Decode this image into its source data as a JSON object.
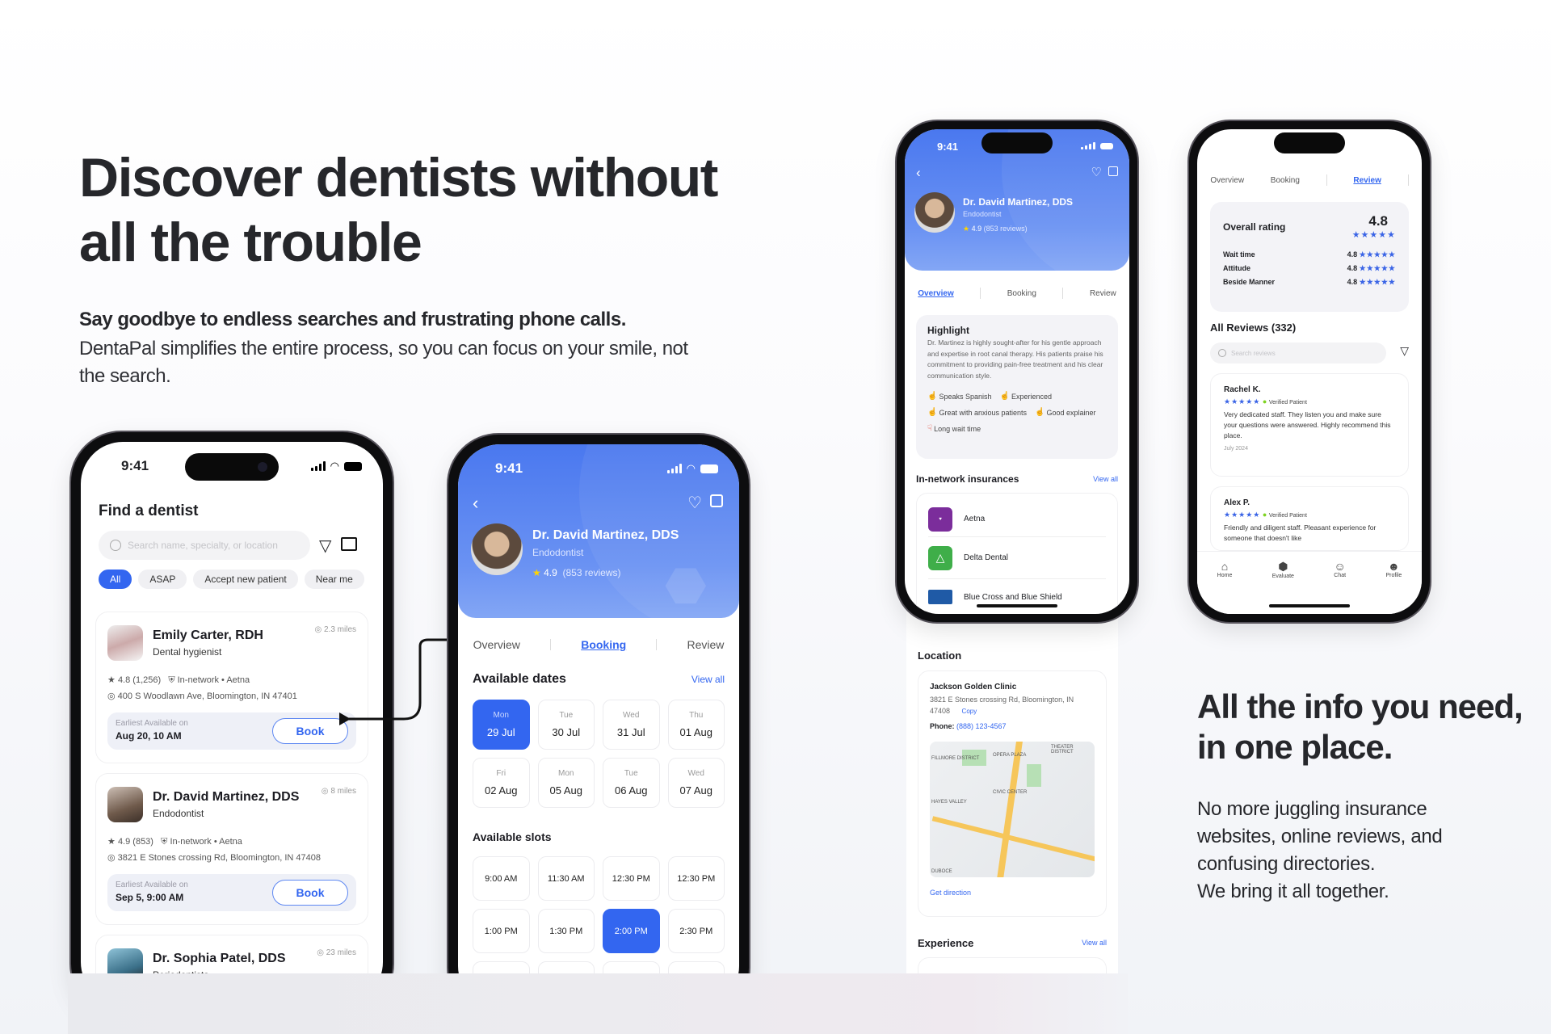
{
  "hero": {
    "title": "Discover dentists without all the trouble",
    "subtitle_bold": "Say goodbye to endless searches and frustrating phone calls.",
    "subtitle": "DentaPal simplifies the entire process, so you can focus on your smile, not the search."
  },
  "info": {
    "title": "All the info you need, in one place.",
    "body_lines": [
      "No more juggling insurance",
      "websites, online reviews, and",
      "confusing directories.",
      "We bring it all together."
    ]
  },
  "status_bar": {
    "time": "9:41"
  },
  "find": {
    "title": "Find a dentist",
    "search_placeholder": "Search name, specialty, or location",
    "chips": [
      "All",
      "ASAP",
      "Accept new patient",
      "Near me"
    ],
    "active_chip": "All",
    "dentists": [
      {
        "name": "Emily Carter, RDH",
        "specialty": "Dental hygienist",
        "distance": "2.3 miles",
        "rating": "4.8 (1,256)",
        "network": "In-network • Aetna",
        "address": "400 S Woodlawn Ave, Bloomington, IN 47401",
        "avail_label": "Earliest Available on",
        "avail": "Aug 20, 10 AM",
        "book": "Book"
      },
      {
        "name": "Dr. David Martinez, DDS",
        "specialty": "Endodontist",
        "distance": "8 miles",
        "rating": "4.9 (853)",
        "network": "In-network • Aetna",
        "address": "3821 E Stones crossing Rd, Bloomington, IN 47408",
        "avail_label": "Earliest Available on",
        "avail": "Sep 5, 9:00 AM",
        "book": "Book"
      },
      {
        "name": "Dr. Sophia Patel, DDS",
        "specialty": "Periodontists",
        "distance": "23 miles"
      }
    ]
  },
  "profile": {
    "name": "Dr. David Martinez, DDS",
    "specialty": "Endodontist",
    "rating": "4.9",
    "reviews": "(853 reviews)",
    "tabs": [
      "Overview",
      "Booking",
      "Review"
    ]
  },
  "booking": {
    "dates_title": "Available dates",
    "view_all": "View all",
    "dates": [
      {
        "day": "Mon",
        "date": "29 Jul",
        "selected": true
      },
      {
        "day": "Tue",
        "date": "30 Jul"
      },
      {
        "day": "Wed",
        "date": "31 Jul"
      },
      {
        "day": "Thu",
        "date": "01 Aug"
      },
      {
        "day": "Fri",
        "date": "02 Aug"
      },
      {
        "day": "Mon",
        "date": "05 Aug"
      },
      {
        "day": "Tue",
        "date": "06 Aug"
      },
      {
        "day": "Wed",
        "date": "07 Aug"
      }
    ],
    "slots_title": "Available slots",
    "slots": [
      "9:00 AM",
      "11:30 AM",
      "12:30 PM",
      "12:30 PM",
      "1:00 PM",
      "1:30 PM",
      "2:00 PM",
      "2:30 PM"
    ],
    "selected_slot": "2:00 PM"
  },
  "overview": {
    "highlight_title": "Highlight",
    "highlight_text": "Dr. Martinez is highly sought-after for his gentle approach and expertise in root canal therapy. His patients praise his commitment to providing pain-free treatment and his clear communication style.",
    "tags_positive": [
      "Speaks Spanish",
      "Experienced",
      "Great with anxious patients",
      "Good explainer"
    ],
    "tags_negative": [
      "Long wait time"
    ],
    "insurance_title": "In-network insurances",
    "view_all": "View all",
    "insurances": [
      "Aetna",
      "Delta Dental",
      "Blue Cross and Blue Shield"
    ],
    "location_title": "Location",
    "clinic": "Jackson Golden Clinic",
    "clinic_address": "3821 E Stones crossing Rd, Bloomington, IN 47408",
    "copy": "Copy",
    "phone_label": "Phone:",
    "phone": "(888) 123-4567",
    "map_labels": [
      "FILLMORE DISTRICT",
      "OPERA PLAZA",
      "THEATER DISTRICT",
      "CIVIC CENTER",
      "HAYES VALLEY",
      "DUBOCE"
    ],
    "get_direction": "Get direction",
    "experience_title": "Experience"
  },
  "review": {
    "tabs": [
      "Overview",
      "Booking",
      "Review"
    ],
    "overall_label": "Overall rating",
    "overall": "4.8",
    "categories": [
      {
        "label": "Wait time",
        "score": "4.8"
      },
      {
        "label": "Attitude",
        "score": "4.8"
      },
      {
        "label": "Beside Manner",
        "score": "4.8"
      }
    ],
    "all_reviews": "All Reviews (332)",
    "search_placeholder": "Search reviews",
    "items": [
      {
        "author": "Rachel K.",
        "verified": "Verified Patient",
        "text": "Very dedicated staff. They listen you and make sure your questions were answered. Highly recommend this place.",
        "date": "July 2024"
      },
      {
        "author": "Alex P.",
        "verified": "Verified Patient",
        "text": "Friendly and diligent staff. Pleasant experience for someone that doesn't like"
      }
    ],
    "nav": [
      "Home",
      "Evaluate",
      "Chat",
      "Profile"
    ]
  },
  "colors": {
    "accent": "#3366f0",
    "header_blue": "#4a78ef",
    "verified_green": "#7ed321",
    "negative": "#e24a3a",
    "aetna_purple": "#7b2d9b",
    "delta_green": "#3fae49"
  }
}
